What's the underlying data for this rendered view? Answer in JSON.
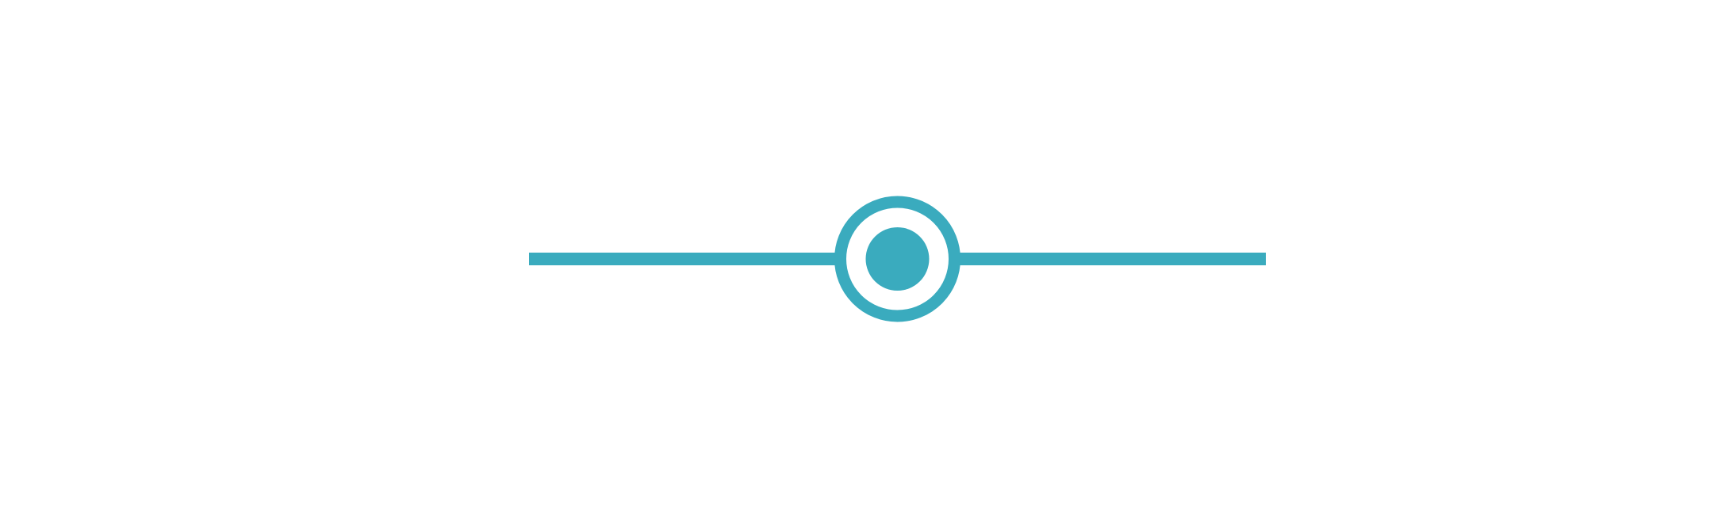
{
  "slider": {
    "value_fraction": 0.5,
    "accent_color": "#3aabbe",
    "thumb_icon": "radio-target-icon"
  }
}
